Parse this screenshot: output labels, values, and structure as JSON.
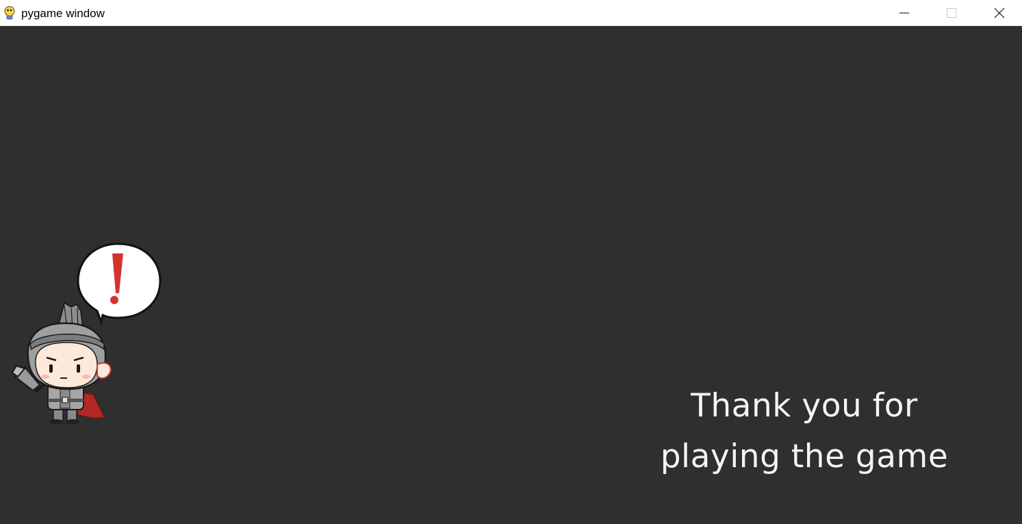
{
  "window": {
    "title": "pygame window",
    "icon": "pygame-snake-icon",
    "controls": [
      "minimize-icon",
      "maximize-icon",
      "close-icon"
    ]
  },
  "game": {
    "background_color": "#2f2f2f",
    "text_color": "#f4f4f4",
    "message_lines": [
      "Thank you for",
      "playing the game"
    ],
    "character": {
      "sprite": "chibi-knight-with-sword",
      "speech_bubble_icon": "exclamation-mark-icon",
      "accent_color": "#d2352f"
    }
  }
}
